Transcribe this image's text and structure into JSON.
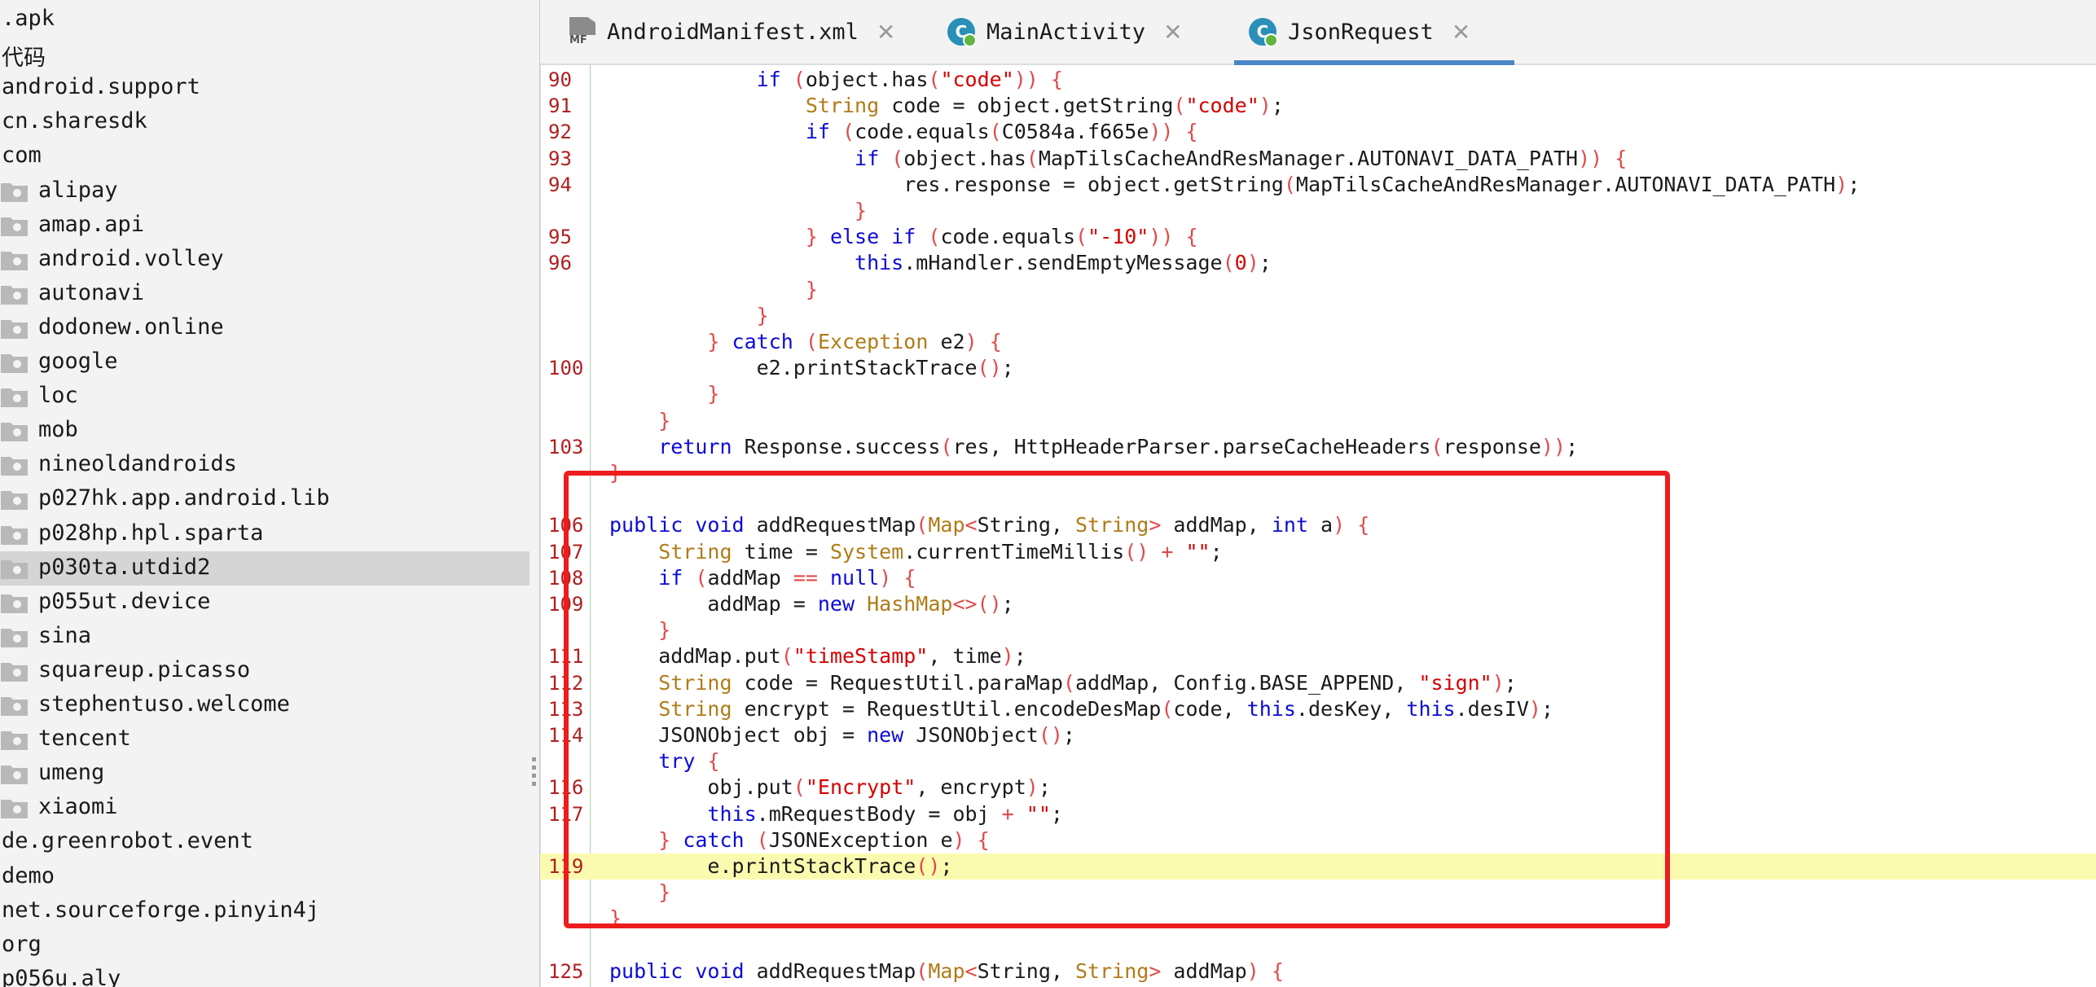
{
  "tree": {
    "items": [
      {
        "label": ".apk",
        "folder": false,
        "indent": 0
      },
      {
        "label": "代码",
        "folder": false,
        "indent": 0
      },
      {
        "label": "android.support",
        "folder": false,
        "indent": 0
      },
      {
        "label": "cn.sharesdk",
        "folder": false,
        "indent": 0
      },
      {
        "label": "com",
        "folder": false,
        "indent": 0
      },
      {
        "label": "alipay",
        "folder": true,
        "indent": 1
      },
      {
        "label": "amap.api",
        "folder": true,
        "indent": 1
      },
      {
        "label": "android.volley",
        "folder": true,
        "indent": 1
      },
      {
        "label": "autonavi",
        "folder": true,
        "indent": 1
      },
      {
        "label": "dodonew.online",
        "folder": true,
        "indent": 1
      },
      {
        "label": "google",
        "folder": true,
        "indent": 1
      },
      {
        "label": "loc",
        "folder": true,
        "indent": 1
      },
      {
        "label": "mob",
        "folder": true,
        "indent": 1
      },
      {
        "label": "nineoldandroids",
        "folder": true,
        "indent": 1
      },
      {
        "label": "p027hk.app.android.lib",
        "folder": true,
        "indent": 1
      },
      {
        "label": "p028hp.hpl.sparta",
        "folder": true,
        "indent": 1
      },
      {
        "label": "p030ta.utdid2",
        "folder": true,
        "indent": 1,
        "selected": true
      },
      {
        "label": "p055ut.device",
        "folder": true,
        "indent": 1
      },
      {
        "label": "sina",
        "folder": true,
        "indent": 1
      },
      {
        "label": "squareup.picasso",
        "folder": true,
        "indent": 1
      },
      {
        "label": "stephentuso.welcome",
        "folder": true,
        "indent": 1
      },
      {
        "label": "tencent",
        "folder": true,
        "indent": 1
      },
      {
        "label": "umeng",
        "folder": true,
        "indent": 1
      },
      {
        "label": "xiaomi",
        "folder": true,
        "indent": 1
      },
      {
        "label": "de.greenrobot.event",
        "folder": false,
        "indent": 0
      },
      {
        "label": "demo",
        "folder": false,
        "indent": 0
      },
      {
        "label": "net.sourceforge.pinyin4j",
        "folder": false,
        "indent": 0
      },
      {
        "label": "org",
        "folder": false,
        "indent": 0
      },
      {
        "label": "p056u.aly",
        "folder": false,
        "indent": 0
      }
    ]
  },
  "tabs": [
    {
      "label": "AndroidManifest.xml",
      "icon": "manifest-icon",
      "active": false
    },
    {
      "label": "MainActivity",
      "icon": "class-icon",
      "active": false
    },
    {
      "label": "JsonRequest",
      "icon": "class-icon",
      "active": true
    }
  ],
  "tab_icon_text": {
    "manifest": "MF",
    "class": "C"
  },
  "close_glyph": "✕",
  "editor": {
    "highlight_line": 119,
    "lines": [
      {
        "n": "90",
        "t": [
          [
            "nm",
            "            "
          ],
          [
            "kw",
            "if"
          ],
          [
            "nm",
            " "
          ],
          [
            "pn",
            "("
          ],
          [
            "nm",
            "object.has"
          ],
          [
            "pn",
            "("
          ],
          [
            "st",
            "\"code\""
          ],
          [
            "pn",
            "))"
          ],
          [
            "nm",
            " "
          ],
          [
            "pn",
            "{"
          ]
        ]
      },
      {
        "n": "91",
        "t": [
          [
            "nm",
            "                "
          ],
          [
            "tp",
            "String"
          ],
          [
            "nm",
            " code = object.getString"
          ],
          [
            "pn",
            "("
          ],
          [
            "st",
            "\"code\""
          ],
          [
            "pn",
            ")"
          ],
          [
            "nm",
            ";"
          ]
        ]
      },
      {
        "n": "92",
        "t": [
          [
            "nm",
            "                "
          ],
          [
            "kw",
            "if"
          ],
          [
            "nm",
            " "
          ],
          [
            "pn",
            "("
          ],
          [
            "nm",
            "code.equals"
          ],
          [
            "pn",
            "("
          ],
          [
            "nm",
            "C0584a.f665e"
          ],
          [
            "pn",
            "))"
          ],
          [
            "nm",
            " "
          ],
          [
            "pn",
            "{"
          ]
        ]
      },
      {
        "n": "93",
        "t": [
          [
            "nm",
            "                    "
          ],
          [
            "kw",
            "if"
          ],
          [
            "nm",
            " "
          ],
          [
            "pn",
            "("
          ],
          [
            "nm",
            "object.has"
          ],
          [
            "pn",
            "("
          ],
          [
            "nm",
            "MapTilsCacheAndResManager.AUTONAVI_DATA_PATH"
          ],
          [
            "pn",
            "))"
          ],
          [
            "nm",
            " "
          ],
          [
            "pn",
            "{"
          ]
        ]
      },
      {
        "n": "94",
        "t": [
          [
            "nm",
            "                        res.response = object.getString"
          ],
          [
            "pn",
            "("
          ],
          [
            "nm",
            "MapTilsCacheAndResManager.AUTONAVI_DATA_PATH"
          ],
          [
            "pn",
            ")"
          ],
          [
            "nm",
            ";"
          ]
        ]
      },
      {
        "n": "",
        "t": [
          [
            "nm",
            "                    "
          ],
          [
            "pn",
            "}"
          ]
        ]
      },
      {
        "n": "95",
        "t": [
          [
            "nm",
            "                "
          ],
          [
            "pn",
            "}"
          ],
          [
            "nm",
            " "
          ],
          [
            "kw",
            "else if"
          ],
          [
            "nm",
            " "
          ],
          [
            "pn",
            "("
          ],
          [
            "nm",
            "code.equals"
          ],
          [
            "pn",
            "("
          ],
          [
            "st",
            "\"-10\""
          ],
          [
            "pn",
            "))"
          ],
          [
            "nm",
            " "
          ],
          [
            "pn",
            "{"
          ]
        ]
      },
      {
        "n": "96",
        "t": [
          [
            "nm",
            "                    "
          ],
          [
            "kw",
            "this"
          ],
          [
            "nm",
            ".mHandler.sendEmptyMessage"
          ],
          [
            "pn",
            "("
          ],
          [
            "st",
            "0"
          ],
          [
            "pn",
            ")"
          ],
          [
            "nm",
            ";"
          ]
        ]
      },
      {
        "n": "",
        "t": [
          [
            "nm",
            "                "
          ],
          [
            "pn",
            "}"
          ]
        ]
      },
      {
        "n": "",
        "t": [
          [
            "nm",
            "            "
          ],
          [
            "pn",
            "}"
          ]
        ]
      },
      {
        "n": "",
        "t": [
          [
            "nm",
            "        "
          ],
          [
            "pn",
            "}"
          ],
          [
            "nm",
            " "
          ],
          [
            "kw",
            "catch"
          ],
          [
            "nm",
            " "
          ],
          [
            "pn",
            "("
          ],
          [
            "tp",
            "Exception"
          ],
          [
            "nm",
            " e2"
          ],
          [
            "pn",
            ")"
          ],
          [
            "nm",
            " "
          ],
          [
            "pn",
            "{"
          ]
        ]
      },
      {
        "n": "100",
        "t": [
          [
            "nm",
            "            e2.printStackTrace"
          ],
          [
            "pn",
            "()"
          ],
          [
            "nm",
            ";"
          ]
        ]
      },
      {
        "n": "",
        "t": [
          [
            "nm",
            "        "
          ],
          [
            "pn",
            "}"
          ]
        ]
      },
      {
        "n": "",
        "t": [
          [
            "nm",
            "    "
          ],
          [
            "pn",
            "}"
          ]
        ]
      },
      {
        "n": "103",
        "t": [
          [
            "nm",
            "    "
          ],
          [
            "kw",
            "return"
          ],
          [
            "nm",
            " Response.success"
          ],
          [
            "pn",
            "("
          ],
          [
            "nm",
            "res, HttpHeaderParser.parseCacheHeaders"
          ],
          [
            "pn",
            "("
          ],
          [
            "nm",
            "response"
          ],
          [
            "pn",
            "))"
          ],
          [
            "nm",
            ";"
          ]
        ]
      },
      {
        "n": "",
        "t": [
          [
            "pn",
            "}"
          ]
        ]
      },
      {
        "n": "",
        "t": []
      },
      {
        "n": "106",
        "t": [
          [
            "kw",
            "public void"
          ],
          [
            "nm",
            " addRequestMap"
          ],
          [
            "pn",
            "("
          ],
          [
            "tp",
            "Map"
          ],
          [
            "pn",
            "<"
          ],
          [
            "nm",
            "String, "
          ],
          [
            "tp",
            "String"
          ],
          [
            "pn",
            ">"
          ],
          [
            "nm",
            " addMap, "
          ],
          [
            "kw",
            "int"
          ],
          [
            "nm",
            " a"
          ],
          [
            "pn",
            ")"
          ],
          [
            "nm",
            " "
          ],
          [
            "pn",
            "{"
          ]
        ]
      },
      {
        "n": "107",
        "t": [
          [
            "nm",
            "    "
          ],
          [
            "tp",
            "String"
          ],
          [
            "nm",
            " time = "
          ],
          [
            "tp",
            "System"
          ],
          [
            "nm",
            ".currentTimeMillis"
          ],
          [
            "pn",
            "()"
          ],
          [
            "nm",
            " "
          ],
          [
            "pn",
            "+"
          ],
          [
            "nm",
            " "
          ],
          [
            "st",
            "\"\""
          ],
          [
            "nm",
            ";"
          ]
        ]
      },
      {
        "n": "108",
        "t": [
          [
            "nm",
            "    "
          ],
          [
            "kw",
            "if"
          ],
          [
            "nm",
            " "
          ],
          [
            "pn",
            "("
          ],
          [
            "nm",
            "addMap "
          ],
          [
            "pn",
            "=="
          ],
          [
            "nm",
            " "
          ],
          [
            "kw",
            "null"
          ],
          [
            "pn",
            ")"
          ],
          [
            "nm",
            " "
          ],
          [
            "pn",
            "{"
          ]
        ]
      },
      {
        "n": "109",
        "t": [
          [
            "nm",
            "        addMap = "
          ],
          [
            "kw",
            "new"
          ],
          [
            "nm",
            " "
          ],
          [
            "tp",
            "HashMap"
          ],
          [
            "pn",
            "<>()"
          ],
          [
            "nm",
            ";"
          ]
        ]
      },
      {
        "n": "",
        "t": [
          [
            "nm",
            "    "
          ],
          [
            "pn",
            "}"
          ]
        ]
      },
      {
        "n": "111",
        "t": [
          [
            "nm",
            "    addMap.put"
          ],
          [
            "pn",
            "("
          ],
          [
            "st",
            "\"timeStamp\""
          ],
          [
            "nm",
            ", time"
          ],
          [
            "pn",
            ")"
          ],
          [
            "nm",
            ";"
          ]
        ]
      },
      {
        "n": "112",
        "t": [
          [
            "nm",
            "    "
          ],
          [
            "tp",
            "String"
          ],
          [
            "nm",
            " code = RequestUtil.paraMap"
          ],
          [
            "pn",
            "("
          ],
          [
            "nm",
            "addMap, Config.BASE_APPEND, "
          ],
          [
            "st",
            "\"sign\""
          ],
          [
            "pn",
            ")"
          ],
          [
            "nm",
            ";"
          ]
        ]
      },
      {
        "n": "113",
        "t": [
          [
            "nm",
            "    "
          ],
          [
            "tp",
            "String"
          ],
          [
            "nm",
            " encrypt = RequestUtil.encodeDesMap"
          ],
          [
            "pn",
            "("
          ],
          [
            "nm",
            "code, "
          ],
          [
            "kw",
            "this"
          ],
          [
            "nm",
            ".desKey, "
          ],
          [
            "kw",
            "this"
          ],
          [
            "nm",
            ".desIV"
          ],
          [
            "pn",
            ")"
          ],
          [
            "nm",
            ";"
          ]
        ]
      },
      {
        "n": "114",
        "t": [
          [
            "nm",
            "    JSONObject obj = "
          ],
          [
            "kw",
            "new"
          ],
          [
            "nm",
            " JSONObject"
          ],
          [
            "pn",
            "()"
          ],
          [
            "nm",
            ";"
          ]
        ]
      },
      {
        "n": "",
        "t": [
          [
            "nm",
            "    "
          ],
          [
            "kw",
            "try"
          ],
          [
            "nm",
            " "
          ],
          [
            "pn",
            "{"
          ]
        ]
      },
      {
        "n": "116",
        "t": [
          [
            "nm",
            "        obj.put"
          ],
          [
            "pn",
            "("
          ],
          [
            "st",
            "\"Encrypt\""
          ],
          [
            "nm",
            ", encrypt"
          ],
          [
            "pn",
            ")"
          ],
          [
            "nm",
            ";"
          ]
        ]
      },
      {
        "n": "117",
        "t": [
          [
            "nm",
            "        "
          ],
          [
            "kw",
            "this"
          ],
          [
            "nm",
            ".mRequestBody = obj "
          ],
          [
            "pn",
            "+"
          ],
          [
            "nm",
            " "
          ],
          [
            "st",
            "\"\""
          ],
          [
            "nm",
            ";"
          ]
        ]
      },
      {
        "n": "",
        "t": [
          [
            "nm",
            "    "
          ],
          [
            "pn",
            "}"
          ],
          [
            "nm",
            " "
          ],
          [
            "kw",
            "catch"
          ],
          [
            "nm",
            " "
          ],
          [
            "pn",
            "("
          ],
          [
            "nm",
            "JSONException e"
          ],
          [
            "pn",
            ")"
          ],
          [
            "nm",
            " "
          ],
          [
            "pn",
            "{"
          ]
        ]
      },
      {
        "n": "119",
        "t": [
          [
            "nm",
            "        e.printStackTrace"
          ],
          [
            "pn",
            "()"
          ],
          [
            "nm",
            ";"
          ]
        ]
      },
      {
        "n": "",
        "t": [
          [
            "nm",
            "    "
          ],
          [
            "pn",
            "}"
          ]
        ]
      },
      {
        "n": "",
        "t": [
          [
            "pn",
            "}"
          ]
        ]
      },
      {
        "n": "",
        "t": []
      },
      {
        "n": "125",
        "t": [
          [
            "kw",
            "public void"
          ],
          [
            "nm",
            " addRequestMap"
          ],
          [
            "pn",
            "("
          ],
          [
            "tp",
            "Map"
          ],
          [
            "pn",
            "<"
          ],
          [
            "nm",
            "String, "
          ],
          [
            "tp",
            "String"
          ],
          [
            "pn",
            ">"
          ],
          [
            "nm",
            " addMap"
          ],
          [
            "pn",
            ")"
          ],
          [
            "nm",
            " "
          ],
          [
            "pn",
            "{"
          ]
        ]
      }
    ]
  }
}
